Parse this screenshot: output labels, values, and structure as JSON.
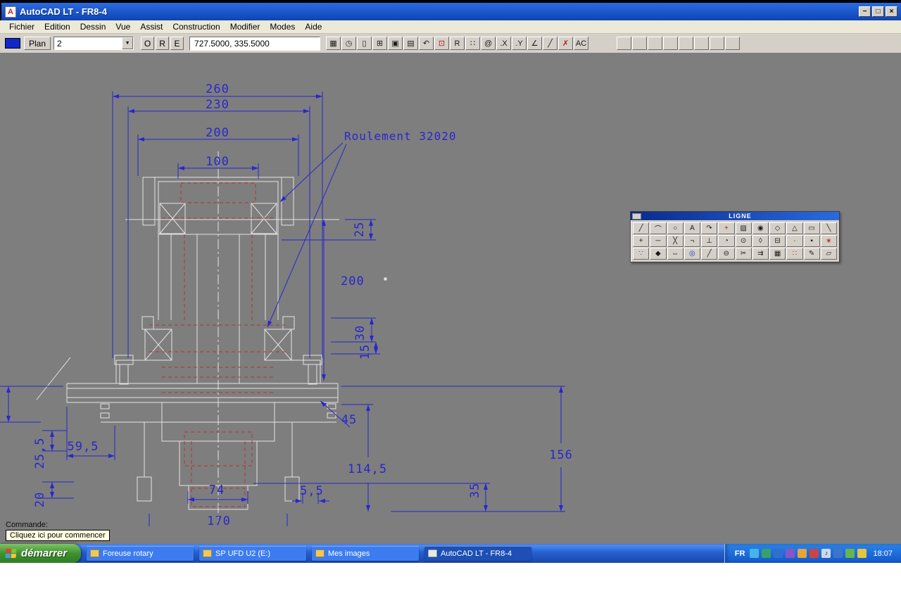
{
  "colors": {
    "dimension_blue": "#2727cf",
    "geometry_white": "#e4e4e4",
    "hidden_red": "#b83030",
    "canvas_gray": "#7e7e7e",
    "swatch_blue": "#1028c8"
  },
  "window": {
    "title": "AutoCAD LT - FR8-4",
    "controls": {
      "minimize": "−",
      "restore": "□",
      "close": "×"
    }
  },
  "menubar": {
    "items": [
      {
        "name": "menu-fichier",
        "label": "Fichier"
      },
      {
        "name": "menu-edition",
        "label": "Edition"
      },
      {
        "name": "menu-dessin",
        "label": "Dessin"
      },
      {
        "name": "menu-vue",
        "label": "Vue"
      },
      {
        "name": "menu-assist",
        "label": "Assist"
      },
      {
        "name": "menu-construction",
        "label": "Construction"
      },
      {
        "name": "menu-modifier",
        "label": "Modifier"
      },
      {
        "name": "menu-modes",
        "label": "Modes"
      },
      {
        "name": "menu-aide",
        "label": "Aide"
      }
    ]
  },
  "toolbar": {
    "plan_label": "Plan",
    "layer_value": "2",
    "dropdown_arrow": "▼",
    "toggles": [
      {
        "name": "toggle-o",
        "label": "O"
      },
      {
        "name": "toggle-r",
        "label": "R"
      },
      {
        "name": "toggle-e",
        "label": "E"
      }
    ],
    "coords": "727.5000, 335.5000",
    "icons": [
      {
        "name": "viewports-icon",
        "glyph": "▦"
      },
      {
        "name": "clock-icon",
        "glyph": "◷"
      },
      {
        "name": "new-file-icon",
        "glyph": "▯"
      },
      {
        "name": "copy-icon",
        "glyph": "⊞"
      },
      {
        "name": "save-icon",
        "glyph": "▣"
      },
      {
        "name": "print-icon",
        "glyph": "▤"
      },
      {
        "name": "undo-icon",
        "glyph": "↶"
      },
      {
        "name": "dim-style-icon",
        "glyph": "⊡",
        "color": "#b02020"
      },
      {
        "name": "redo-icon",
        "glyph": "R"
      },
      {
        "name": "grid-points-icon",
        "glyph": "∷"
      },
      {
        "name": "at-icon",
        "glyph": "@"
      },
      {
        "name": "point-x-icon",
        "glyph": ".X"
      },
      {
        "name": "point-y-icon",
        "glyph": ".Y"
      },
      {
        "name": "angle-icon",
        "glyph": "∠"
      },
      {
        "name": "line-draw-icon",
        "glyph": "╱"
      },
      {
        "name": "erase-icon",
        "glyph": "✗",
        "color": "#b02020"
      },
      {
        "name": "ac-icon",
        "glyph": "AC"
      }
    ],
    "blanks": [
      {
        "name": "empty-button"
      },
      {
        "name": "empty-button"
      },
      {
        "name": "empty-button"
      },
      {
        "name": "empty-button"
      },
      {
        "name": "empty-button"
      },
      {
        "name": "empty-button"
      },
      {
        "name": "empty-button"
      },
      {
        "name": "empty-button"
      }
    ]
  },
  "palette": {
    "title": "LIGNE",
    "tools": [
      {
        "name": "line-tool-icon",
        "glyph": "╱"
      },
      {
        "name": "arc-tool-icon",
        "glyph": "⌒"
      },
      {
        "name": "circle-tool-icon",
        "glyph": "○"
      },
      {
        "name": "text-tool-icon",
        "glyph": "A"
      },
      {
        "name": "arc-continue-tool-icon",
        "glyph": "↷"
      },
      {
        "name": "point-tool-icon",
        "glyph": "+",
        "color": "#b02020"
      },
      {
        "name": "hatch-tool-icon",
        "glyph": "▨"
      },
      {
        "name": "donut-tool-icon",
        "glyph": "◉"
      },
      {
        "name": "ellipse-tool-icon",
        "glyph": "◇"
      },
      {
        "name": "polygon-tool-icon",
        "glyph": "△"
      },
      {
        "name": "rectangle-tool-icon",
        "glyph": "▭"
      },
      {
        "name": "sketch-tool-icon",
        "glyph": "╲"
      },
      {
        "name": "point-style-tool-icon",
        "glyph": "+"
      },
      {
        "name": "segment-tool-icon",
        "glyph": "─"
      },
      {
        "name": "xline-tool-icon",
        "glyph": "╳"
      },
      {
        "name": "ray-tool-icon",
        "glyph": "¬"
      },
      {
        "name": "perpendicular-tool-icon",
        "glyph": "⊥"
      },
      {
        "name": "arc-quadrant-tool-icon",
        "glyph": "◔"
      },
      {
        "name": "circle-radius-tool-icon",
        "glyph": "⊙"
      },
      {
        "name": "hexagon-tool-icon",
        "glyph": "◊"
      },
      {
        "name": "mtext-tool-icon",
        "glyph": "⊟"
      },
      {
        "name": "dot-tool-icon",
        "glyph": "·"
      },
      {
        "name": "solid-tool-icon",
        "glyph": "▪"
      },
      {
        "name": "star-tool-icon",
        "glyph": "∗",
        "color": "#b02020"
      },
      {
        "name": "group-tool-icon",
        "glyph": "∵",
        "color": "#2040c0"
      },
      {
        "name": "eraser-tool-icon",
        "glyph": "◆"
      },
      {
        "name": "stretch-tool-icon",
        "glyph": "⇔"
      },
      {
        "name": "zoom-tool-icon",
        "glyph": "◎",
        "color": "#2040c0"
      },
      {
        "name": "mirror-tool-icon",
        "glyph": "╱"
      },
      {
        "name": "oblong-tool-icon",
        "glyph": "⊖"
      },
      {
        "name": "trim-tool-icon",
        "glyph": "✂"
      },
      {
        "name": "extend-tool-icon",
        "glyph": "⇉"
      },
      {
        "name": "array-tool-icon",
        "glyph": "▦"
      },
      {
        "name": "pattern-tool-icon",
        "glyph": "∷",
        "color": "#b02020"
      },
      {
        "name": "brush-tool-icon",
        "glyph": "✎"
      },
      {
        "name": "region-tool-icon",
        "glyph": "▱"
      }
    ]
  },
  "drawing": {
    "label": "Roulement 32020",
    "dims": {
      "w260": "260",
      "w230": "230",
      "w200": "200",
      "w100": "100",
      "v25": "25",
      "v200": "200",
      "v30": "30",
      "v15": "15",
      "l45": "45",
      "h156": "156",
      "h114": "114,5",
      "v35": "35",
      "s55": "5,5",
      "w74": "74",
      "w170": "170",
      "w595": "59,5",
      "v255": "25,5",
      "v20": "20"
    }
  },
  "command": {
    "prompt": "Commande:",
    "tooltip": "Cliquez ici pour commencer"
  },
  "taskbar": {
    "start_label": "démarrer",
    "tasks": [
      {
        "name": "task-foreuse-rotary",
        "label": "Foreuse rotary",
        "bg": "#3c7cf0",
        "icon_bg": "#f0c85a"
      },
      {
        "name": "task-sp-ufd-u2",
        "label": "SP UFD U2 (E:)",
        "bg": "#3c7cf0",
        "icon_bg": "#f0c85a"
      },
      {
        "name": "task-mes-images",
        "label": "Mes images",
        "bg": "#3c7cf0",
        "icon_bg": "#f0c85a"
      },
      {
        "name": "task-autocad",
        "label": "AutoCAD LT - FR8-4",
        "bg": "#1d4fb4",
        "icon_bg": "#e8e8e8"
      }
    ],
    "tray": {
      "language": "FR",
      "time": "18:07",
      "icons": [
        {
          "name": "wheel-icon",
          "bg": "#46b4e8",
          "glyph": ""
        },
        {
          "name": "antivirus-icon",
          "bg": "#38a169",
          "glyph": ""
        },
        {
          "name": "shield-icon",
          "bg": "#2f6fd0",
          "glyph": ""
        },
        {
          "name": "display-icon",
          "bg": "#8856c8",
          "glyph": ""
        },
        {
          "name": "update-icon",
          "bg": "#e8a33d",
          "glyph": ""
        },
        {
          "name": "alert-icon",
          "bg": "#cc4444",
          "glyph": ""
        },
        {
          "name": "volume-icon",
          "bg": "#cfd8ea",
          "glyph": "♪"
        },
        {
          "name": "network-icon",
          "bg": "#3f74c9",
          "glyph": ""
        },
        {
          "name": "usb-icon",
          "bg": "#69b54c",
          "glyph": ""
        },
        {
          "name": "messenger-icon",
          "bg": "#e3c63f",
          "glyph": ""
        }
      ]
    }
  }
}
